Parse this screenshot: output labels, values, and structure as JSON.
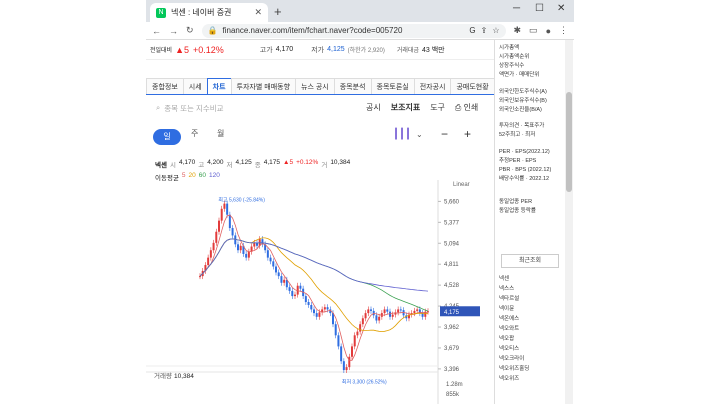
{
  "browser": {
    "tab_title": "넥센 : 네이버 증권",
    "favicon_text": "N",
    "url": "finance.naver.com/item/fchart.naver?code=005720"
  },
  "pricebar": {
    "prev_label": "전일대비",
    "prev_change": "▲5",
    "prev_pct": "+0.12%",
    "high_label": "고가",
    "high": "4,170",
    "low_label": "저가",
    "low": "4,125",
    "lower_limit": "(하한가 2,920)",
    "amount_label": "거래대금",
    "amount": "43 백만"
  },
  "nav_tabs": [
    "종합정보",
    "시세",
    "차트",
    "투자자별 매매동향",
    "뉴스 공시",
    "종목분석",
    "종목토론실",
    "전자공시",
    "공매도현황"
  ],
  "active_tab": "차트",
  "search_placeholder": "종목 또는 지수비교",
  "tools": [
    "공시",
    "보조지표",
    "도구",
    "인쇄"
  ],
  "periods": [
    "일",
    "주",
    "월"
  ],
  "ohlc": {
    "name": "넥센",
    "open_label": "시",
    "open": "4,170",
    "high_label": "고",
    "high": "4,200",
    "low_label": "저",
    "low": "4,125",
    "close_label": "종",
    "close": "4,175",
    "change": "▲5",
    "pct": "+0.12%",
    "vol_label": "거",
    "vol": "10,384"
  },
  "ma": {
    "label": "이동평균",
    "v5": "5",
    "v20": "20",
    "v60": "60",
    "v120": "120"
  },
  "chart_data": {
    "type": "line",
    "scale_label": "Linear",
    "y_ticks": [
      "5,660",
      "5,377",
      "5,094",
      "4,811",
      "4,528",
      "4,245",
      "3,962",
      "3,679",
      "3,396"
    ],
    "y_tick_values": [
      5660,
      5377,
      5094,
      4811,
      4528,
      4245,
      3962,
      3679,
      3396
    ],
    "ylim": [
      3300,
      5760
    ],
    "last_price": "4,175",
    "max_label": "최고 5,630 (-25.84%)",
    "min_label": "최저 3,300 (26.52%)",
    "close_series": [
      4650,
      4720,
      4800,
      4900,
      5000,
      5100,
      5250,
      5400,
      5560,
      5630,
      5480,
      5300,
      5200,
      5080,
      5000,
      5060,
      4950,
      4900,
      4980,
      5050,
      5100,
      5060,
      5150,
      5080,
      5000,
      4900,
      4850,
      4780,
      4700,
      4650,
      4560,
      4600,
      4500,
      4450,
      4380,
      4400,
      4520,
      4480,
      4380,
      4300,
      4260,
      4200,
      4150,
      4100,
      4160,
      4200,
      4230,
      4200,
      4150,
      4000,
      3850,
      3700,
      3500,
      3380,
      3420,
      3560,
      3700,
      3850,
      3900,
      4000,
      4080,
      4150,
      4200,
      4180,
      4120,
      4050,
      4100,
      4150,
      4200,
      4170,
      4100,
      4130,
      4160,
      4200,
      4190,
      4120,
      4080,
      4130,
      4150,
      4180,
      4200,
      4150,
      4100,
      4170,
      4175
    ]
  },
  "volume": {
    "label": "거래량",
    "value": "10,384",
    "ticks": [
      "1.28m",
      "855k"
    ]
  },
  "sidebar": {
    "top": [
      "시가총액",
      "시가총액순위",
      "상장주식수",
      "액면가 · 매매단위"
    ],
    "foreign": [
      "외국인한도주식수(A)",
      "외국인보유주식수(B)",
      "외국인소진율(B/A)"
    ],
    "opinion": [
      "투자의견 · 목표주가",
      "52주최고 · 최저"
    ],
    "per": [
      "PER · EPS(2022.12)",
      "추정PER · EPS",
      "PBR · BPS (2022.12)",
      "배당수익률 · 2022.12"
    ],
    "industry": [
      "동일업종 PER",
      "동일업종 등락률"
    ],
    "recent_title": "최근조회",
    "recent": [
      "넥센",
      "넥스스",
      "넥타르설",
      "넥이뮨",
      "넥온에스",
      "넥오와트",
      "넥오팝",
      "넥오티스",
      "넥오크라이",
      "넥오위즈홀딩",
      "넥오위즈"
    ]
  }
}
